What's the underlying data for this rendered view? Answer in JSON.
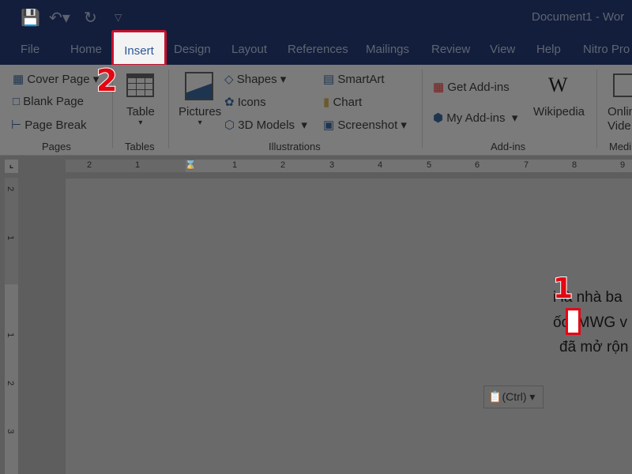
{
  "window": {
    "title": "Document1  -  Wor"
  },
  "qat": {
    "save": "save-icon",
    "undo": "undo-icon",
    "redo": "redo-icon",
    "customize": "customize-icon"
  },
  "tabs": [
    {
      "label": "File"
    },
    {
      "label": "Home"
    },
    {
      "label": "Insert",
      "active": true
    },
    {
      "label": "Design"
    },
    {
      "label": "Layout"
    },
    {
      "label": "References"
    },
    {
      "label": "Mailings"
    },
    {
      "label": "Review"
    },
    {
      "label": "View"
    },
    {
      "label": "Help"
    },
    {
      "label": "Nitro Pro"
    }
  ],
  "ribbon": {
    "pages": {
      "label": "Pages",
      "items": [
        "Cover Page",
        "Blank Page",
        "Page Break"
      ]
    },
    "tables": {
      "label": "Tables",
      "items": [
        "Table"
      ]
    },
    "illustrations": {
      "label": "Illustrations",
      "pictures": "Pictures",
      "items": [
        "Shapes",
        "Icons",
        "3D Models",
        "SmartArt",
        "Chart",
        "Screenshot"
      ]
    },
    "addins": {
      "label": "Add-ins",
      "items": [
        "Get Add-ins",
        "My Add-ins",
        "Wikipedia"
      ]
    },
    "media": {
      "label": "Medi",
      "items": [
        "Onlin",
        "Vide"
      ]
    }
  },
  "ruler": {
    "labels": [
      "2",
      "1",
      "1",
      "2",
      "3",
      "4",
      "5",
      "6",
      "7",
      "8",
      "9"
    ]
  },
  "vruler": {
    "labels": [
      "2",
      "1",
      "1",
      "2",
      "3"
    ]
  },
  "document": {
    "lines": [
      "i là nhà ba",
      "ốc. MWG v",
      "đã mở rộn"
    ]
  },
  "paste_options": {
    "label": "(Ctrl)"
  },
  "annotations": {
    "step1": "1",
    "step2": "2"
  },
  "colors": {
    "titlebar": "#121e3b",
    "highlight": "#c8102e",
    "active_tab_text": "#2b579a"
  }
}
